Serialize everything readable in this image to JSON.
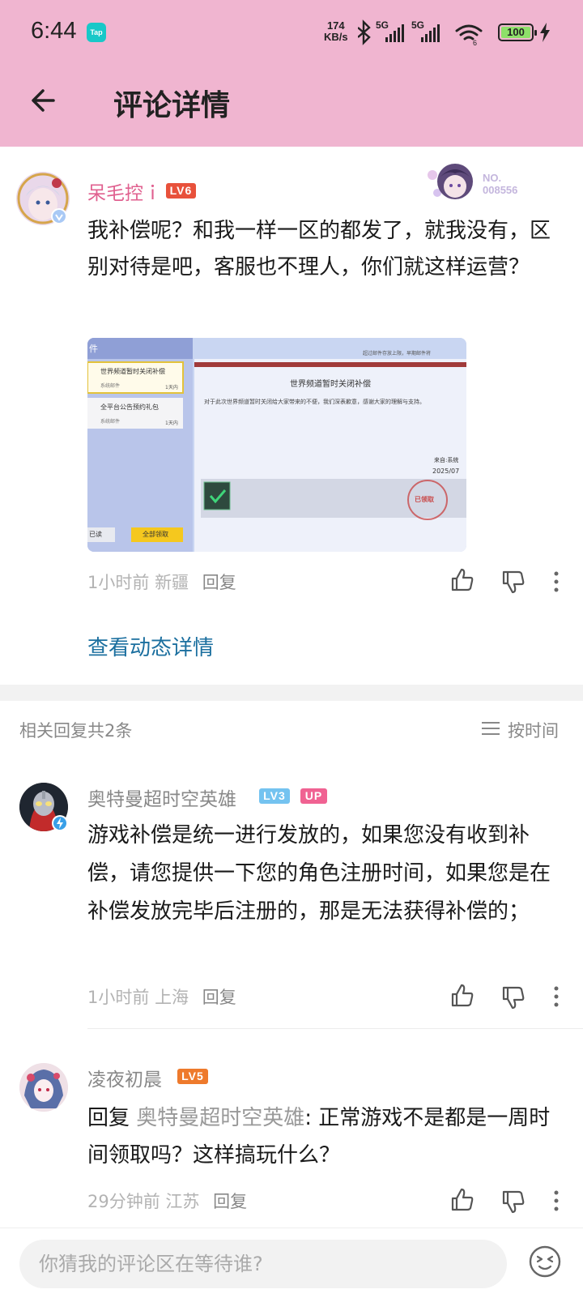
{
  "status_bar": {
    "time": "6:44",
    "app_badge": "Tap",
    "net_speed_value": "174",
    "net_speed_unit": "KB/s",
    "sim1": "5G",
    "sim2": "5G",
    "battery": "100"
  },
  "header": {
    "title": "评论详情"
  },
  "main_comment": {
    "username": "呆毛控ｉ",
    "level": "LV6",
    "badge_no_label": "NO.",
    "badge_no_value": "008556",
    "text": "我补偿呢？和我一样一区的都发了，就我没有，区别对待是吧，客服也不理人，你们就这样运营？",
    "time": "1小时前",
    "location": "新疆",
    "reply_label": "回复",
    "view_detail": "查看动态详情",
    "screenshot": {
      "tab_label": "件",
      "mail1_title": "世界频道暂时关闭补偿",
      "mail1_sender": "系统邮件",
      "mail1_days": "1天内",
      "mail2_title": "全平台公告预约礼包",
      "mail2_sender": "系统邮件",
      "mail2_days": "1天内",
      "header_hint": "超过邮件存放上限，早期邮件将",
      "detail_title": "世界频道暂时关闭补偿",
      "detail_body": "对于此次世界频道暂时关闭给大家带来的不便，我们深表歉意，感谢大家的理解与支持。",
      "from": "来自:系统",
      "date": "2025/07",
      "stamp": "已领取",
      "read_btn": "已读",
      "claim_all_btn": "全部领取"
    }
  },
  "replies_header": {
    "count_label": "相关回复共2条",
    "sort_label": "按时间"
  },
  "replies": [
    {
      "username": "奥特曼超时空英雄",
      "level": "LV3",
      "up_badge": "UP",
      "text": "游戏补偿是统一进行发放的，如果您没有收到补偿，请您提供一下您的角色注册时间，如果您是在补偿发放完毕后注册的，那是无法获得补偿的；",
      "time": "1小时前",
      "location": "上海",
      "reply_label": "回复"
    },
    {
      "username": "凌夜初晨",
      "level": "LV5",
      "reply_prefix": "回复 ",
      "reply_to": "奥特曼超时空英雄",
      "text": ": 正常游戏不是都是一周时间领取吗？这样搞玩什么？",
      "time": "29分钟前",
      "location": "江苏",
      "reply_label": "回复"
    }
  ],
  "bottom_bar": {
    "placeholder": "你猜我的评论区在等待谁?"
  },
  "colors": {
    "header_bg": "#f0b5d0",
    "username_pink": "#e0608f",
    "link_blue": "#1b6f9f",
    "lv6": "#e8513b",
    "lv3": "#74c3f0",
    "lv5": "#ee7a2c",
    "up_badge": "#f06292"
  }
}
